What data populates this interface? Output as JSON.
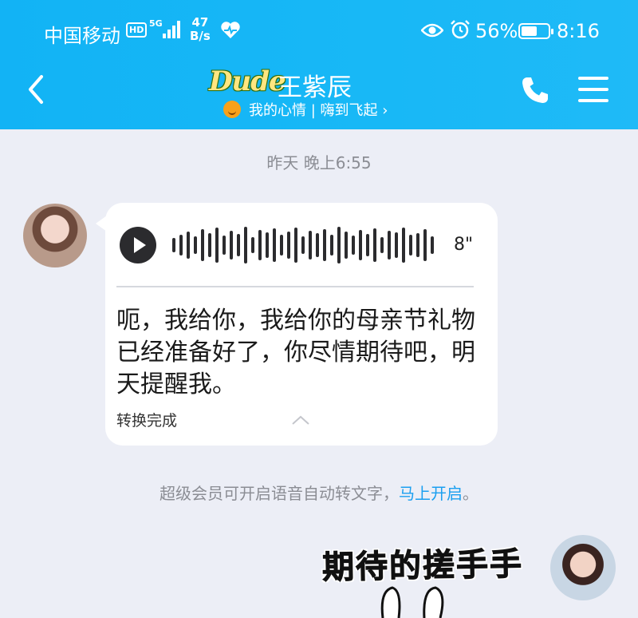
{
  "status_bar": {
    "carrier": "中国移动",
    "hd": "HD",
    "net": "5G",
    "speed_value": "47",
    "speed_unit": "B/s",
    "battery": "56%",
    "battery_level": 0.56,
    "time": "8:16"
  },
  "header": {
    "badge": "Dude",
    "contact_name": "王紫辰",
    "mood_text": "我的心情 | 嗨到飞起 ›"
  },
  "chat": {
    "timestamp": "昨天 晚上6:55",
    "voice_message": {
      "duration": "8\"",
      "transcript": "呃，我给你，我给你的母亲节礼物已经准备好了，你尽情期待吧，明天提醒我。",
      "status": "转换完成"
    },
    "vip_tip": {
      "text": "超级会员可开启语音自动转文字，",
      "link": "马上开启",
      "suffix": "。"
    },
    "sticker_text": "期待的搓手手"
  },
  "colors": {
    "header_bg": "#12b3f5",
    "chat_bg": "#eceef6",
    "link": "#1a9ff0"
  }
}
